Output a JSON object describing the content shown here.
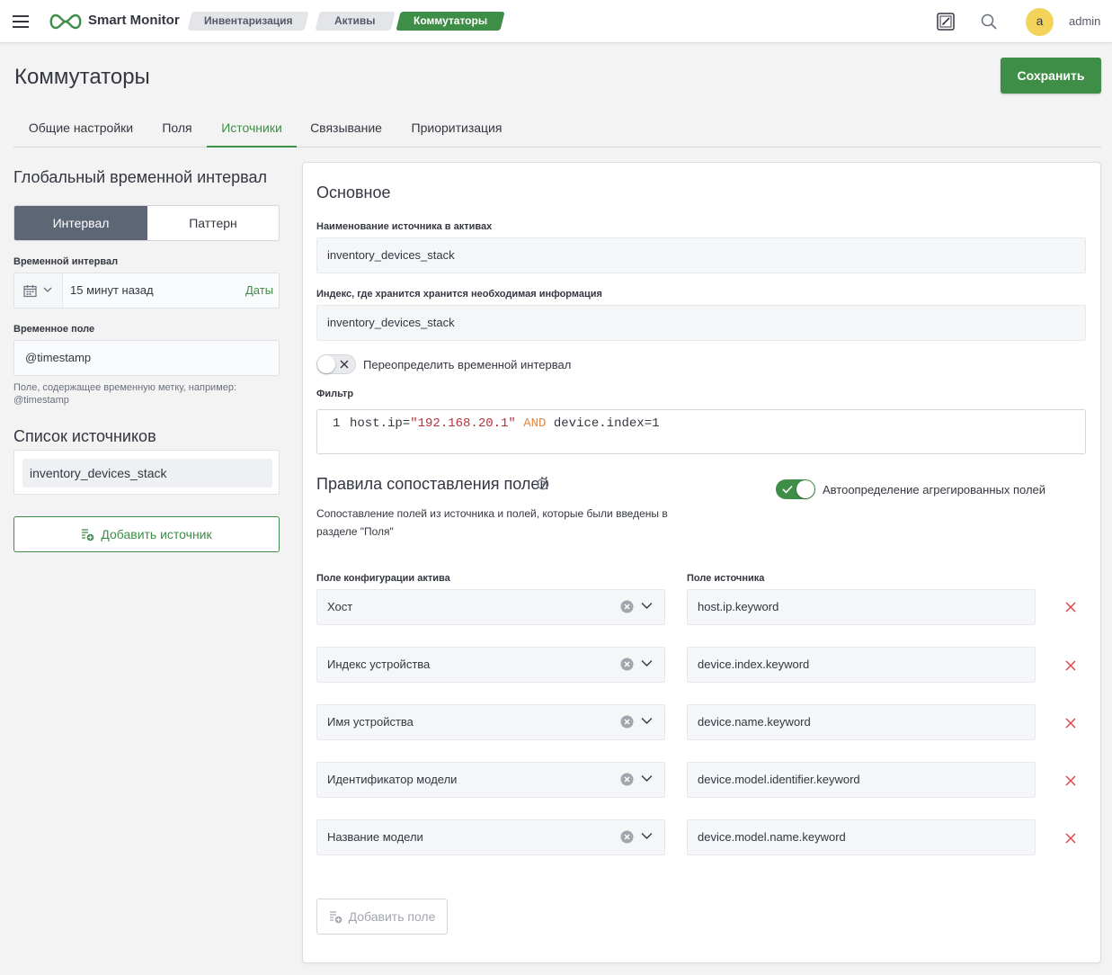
{
  "header": {
    "app_name": "Smart Monitor",
    "breadcrumbs": [
      "Инвентаризация",
      "Активы",
      "Коммутаторы"
    ],
    "user_initial": "a",
    "user_name": "admin"
  },
  "page": {
    "title": "Коммутаторы",
    "save_label": "Сохранить",
    "tabs": [
      "Общие настройки",
      "Поля",
      "Источники",
      "Связывание",
      "Приоритизация"
    ],
    "active_tab": "Источники"
  },
  "left": {
    "time_heading": "Глобальный временной интервал",
    "mode_interval": "Интервал",
    "mode_pattern": "Паттерн",
    "interval_label": "Временной интервал",
    "interval_value": "15 минут назад",
    "dates_link": "Даты",
    "time_field_label": "Временное поле",
    "time_field_value": "@timestamp",
    "time_field_help": "Поле, содержащее временную метку, например: @timestamp",
    "sources_heading": "Список источников",
    "sources": [
      "inventory_devices_stack"
    ],
    "add_source_label": "Добавить источник"
  },
  "main": {
    "basic_heading": "Основное",
    "source_name_label": "Наименование источника в активах",
    "source_name_value": "inventory_devices_stack",
    "index_label": "Индекс, где хранится хранится необходимая информация",
    "index_value": "inventory_devices_stack",
    "override_label": "Переопределить временной интервал",
    "override_on": false,
    "filter_label": "Фильтр",
    "filter_line_number": "1",
    "filter_tokens": {
      "field1": "host.ip=",
      "string1": "\"192.168.20.1\"",
      "keyword": "AND",
      "rest": "device.index=1"
    },
    "mapping_heading": "Правила сопоставления полей",
    "auto_detect_label": "Автоопределение агрегированных полей",
    "auto_detect_on": true,
    "mapping_desc": "Сопоставление полей из источника и полей, которые были введены в разделе \"Поля\"",
    "col_asset_field": "Поле конфигурации актива",
    "col_source_field": "Поле источника",
    "mappings": [
      {
        "asset": "Хост",
        "source": "host.ip.keyword"
      },
      {
        "asset": "Индекс устройства",
        "source": "device.index.keyword"
      },
      {
        "asset": "Имя устройства",
        "source": "device.name.keyword"
      },
      {
        "asset": "Идентификатор модели",
        "source": "device.model.identifier.keyword"
      },
      {
        "asset": "Название модели",
        "source": "device.model.name.keyword"
      }
    ],
    "add_field_label": "Добавить поле"
  },
  "colors": {
    "accent": "#3e8e47",
    "danger": "#e0454c",
    "string": "#b8323a",
    "keyword": "#e8873a"
  }
}
